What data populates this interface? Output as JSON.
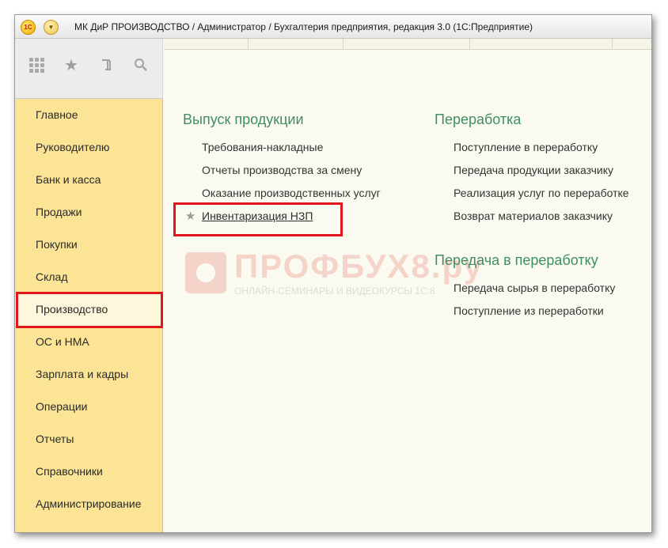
{
  "window": {
    "logo_text": "1C",
    "title": "МК ДиР ПРОИЗВОДСТВО / Администратор / Бухгалтерия предприятия, редакция 3.0  (1С:Предприятие)"
  },
  "toolbar": {
    "icons": [
      "apps-grid-icon",
      "favorites-star-icon",
      "history-icon",
      "search-icon"
    ]
  },
  "sidebar": {
    "items": [
      {
        "label": "Главное"
      },
      {
        "label": "Руководителю"
      },
      {
        "label": "Банк и касса"
      },
      {
        "label": "Продажи"
      },
      {
        "label": "Покупки"
      },
      {
        "label": "Склад"
      },
      {
        "label": "Производство",
        "active": true
      },
      {
        "label": "ОС и НМА"
      },
      {
        "label": "Зарплата и кадры"
      },
      {
        "label": "Операции"
      },
      {
        "label": "Отчеты"
      },
      {
        "label": "Справочники"
      },
      {
        "label": "Администрирование"
      }
    ]
  },
  "sections": {
    "output": {
      "title": "Выпуск продукции",
      "items": [
        "Требования-накладные",
        "Отчеты производства за смену",
        "Оказание производственных услуг",
        "Инвентаризация НЗП"
      ]
    },
    "processing": {
      "title": "Переработка",
      "items": [
        "Поступление в переработку",
        "Передача продукции заказчику",
        "Реализация услуг по переработке",
        "Возврат материалов заказчику"
      ]
    },
    "transfer": {
      "title": "Передача в переработку",
      "items": [
        "Передача сырья в переработку",
        "Поступление из переработки"
      ]
    }
  },
  "watermark": {
    "brand": "ПРОФБУХ8.ру",
    "tagline": "ОНЛАЙН-СЕМИНАРЫ И ВИДЕОКУРСЫ 1С:8"
  },
  "colors": {
    "section_title": "#3f8f63",
    "sidebar_bg": "#fbe496",
    "highlight": "#e0181e"
  }
}
